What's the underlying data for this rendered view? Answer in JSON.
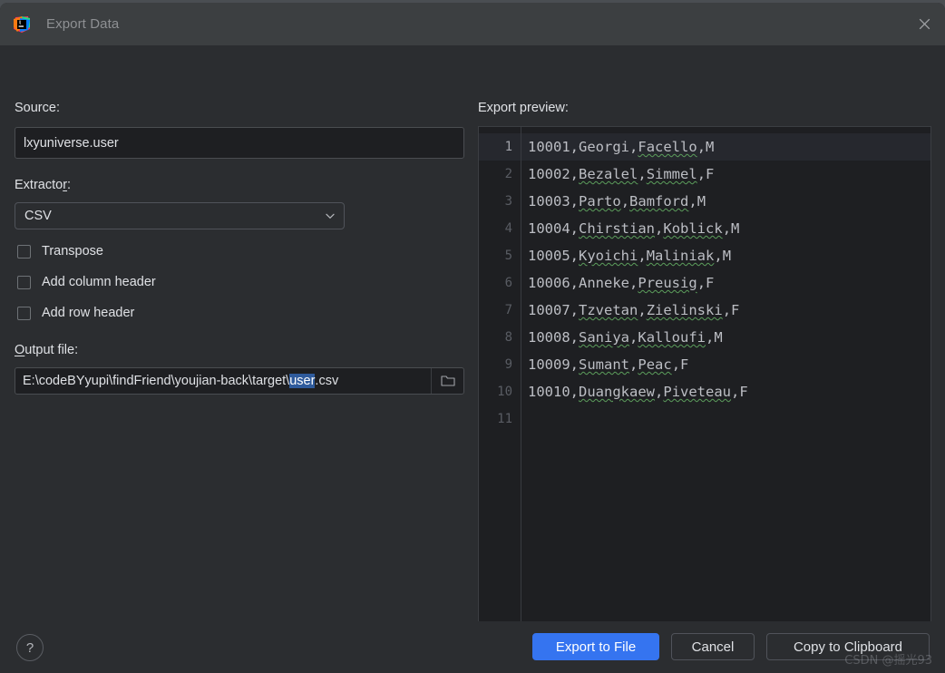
{
  "window": {
    "title": "Export Data",
    "app_icon": "intellij-idea-logo",
    "close_icon": "close-icon"
  },
  "form": {
    "source_label": "Source:",
    "source_value": "lxyuniverse.user",
    "extractor_label_pre": "Extracto",
    "extractor_label_mn": "r",
    "extractor_label_post": ":",
    "extractor_value": "CSV",
    "extractor_chevron": "chevron-down-icon",
    "checkboxes": [
      {
        "label": "Transpose",
        "checked": false
      },
      {
        "label": "Add column header",
        "checked": false
      },
      {
        "label": "Add row header",
        "checked": false
      }
    ],
    "output_label_mn": "O",
    "output_label_post": "utput file:",
    "output_path_prefix": "E:\\codeBYyupi\\findFriend\\youjian-back\\target\\",
    "output_path_selected": "user",
    "output_path_suffix": ".csv",
    "folder_icon": "folder-icon"
  },
  "preview": {
    "label": "Export preview:",
    "current_line": 1,
    "lines": [
      {
        "n": "1",
        "cols": [
          "10001",
          "Georgi",
          "Facello",
          "M"
        ],
        "misspelled": [
          2
        ]
      },
      {
        "n": "2",
        "cols": [
          "10002",
          "Bezalel",
          "Simmel",
          "F"
        ],
        "misspelled": [
          1,
          2
        ]
      },
      {
        "n": "3",
        "cols": [
          "10003",
          "Parto",
          "Bamford",
          "M"
        ],
        "misspelled": [
          1,
          2
        ]
      },
      {
        "n": "4",
        "cols": [
          "10004",
          "Chirstian",
          "Koblick",
          "M"
        ],
        "misspelled": [
          1,
          2
        ]
      },
      {
        "n": "5",
        "cols": [
          "10005",
          "Kyoichi",
          "Maliniak",
          "M"
        ],
        "misspelled": [
          1,
          2
        ]
      },
      {
        "n": "6",
        "cols": [
          "10006",
          "Anneke",
          "Preusig",
          "F"
        ],
        "misspelled": [
          2
        ]
      },
      {
        "n": "7",
        "cols": [
          "10007",
          "Tzvetan",
          "Zielinski",
          "F"
        ],
        "misspelled": [
          1,
          2
        ]
      },
      {
        "n": "8",
        "cols": [
          "10008",
          "Saniya",
          "Kalloufi",
          "M"
        ],
        "misspelled": [
          1,
          2
        ]
      },
      {
        "n": "9",
        "cols": [
          "10009",
          "Sumant",
          "Peac",
          "F"
        ],
        "misspelled": [
          1,
          2
        ]
      },
      {
        "n": "10",
        "cols": [
          "10010",
          "Duangkaew",
          "Piveteau",
          "F"
        ],
        "misspelled": [
          1,
          2
        ]
      },
      {
        "n": "11",
        "cols": [],
        "misspelled": []
      }
    ]
  },
  "footer": {
    "help_label": "?",
    "export_label": "Export to File",
    "cancel_label": "Cancel",
    "copy_label": "Copy to Clipboard"
  },
  "watermark": "CSDN @摇光93",
  "colors": {
    "accent": "#3574f0",
    "dialog_bg": "#2b2d30",
    "titlebar_bg": "#3c3f41",
    "field_bg": "#1e1f22",
    "text": "#dfe1e5",
    "selection": "#2f5b9c",
    "squiggle": "#5c9e5c"
  }
}
